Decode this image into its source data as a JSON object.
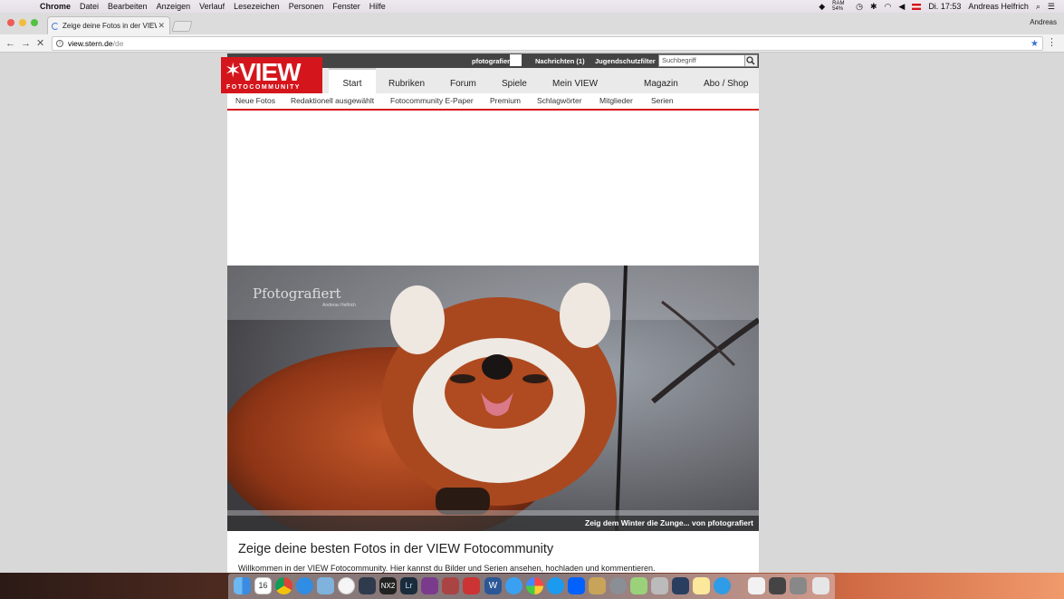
{
  "menubar": {
    "app": "Chrome",
    "items": [
      "Datei",
      "Bearbeiten",
      "Anzeigen",
      "Verlauf",
      "Lesezeichen",
      "Personen",
      "Fenster",
      "Hilfe"
    ],
    "ram": "RAM 54%",
    "clock": "Di. 17:53",
    "user": "Andreas Helfrich"
  },
  "browser": {
    "tab_title": "Zeige deine Fotos in der VIEW",
    "profile": "Andreas",
    "url_host": "view.stern.de",
    "url_path": "/de"
  },
  "site": {
    "top_strip": {
      "username": "pfotografiert",
      "messages": "Nachrichten (1)",
      "youth_filter": "Jugendschutzfilter",
      "search_placeholder": "Suchbegriff"
    },
    "logo": {
      "big": "VIEW",
      "small": "FOTOCOMMUNITY"
    },
    "main_nav": [
      "Start",
      "Rubriken",
      "Forum",
      "Spiele",
      "Mein VIEW",
      "Magazin",
      "Abo / Shop"
    ],
    "sub_nav": [
      "Neue Fotos",
      "Redaktionell ausgewählt",
      "Fotocommunity E-Paper",
      "Premium",
      "Schlagwörter",
      "Mitglieder",
      "Serien"
    ],
    "hero": {
      "watermark": "Pfotografiert",
      "watermark_sub": "Andreas Helfrich",
      "caption": "Zeig dem Winter die Zunge... von pfotografiert"
    },
    "headline": "Zeige deine besten Fotos in der VIEW Fotocommunity",
    "intro": "Willkommen in der VIEW Fotocommunity. Hier kannst du Bilder und Serien ansehen, hochladen und kommentieren."
  },
  "colors": {
    "brand_red": "#d4161c",
    "accent_blue": "#3a72d6"
  }
}
